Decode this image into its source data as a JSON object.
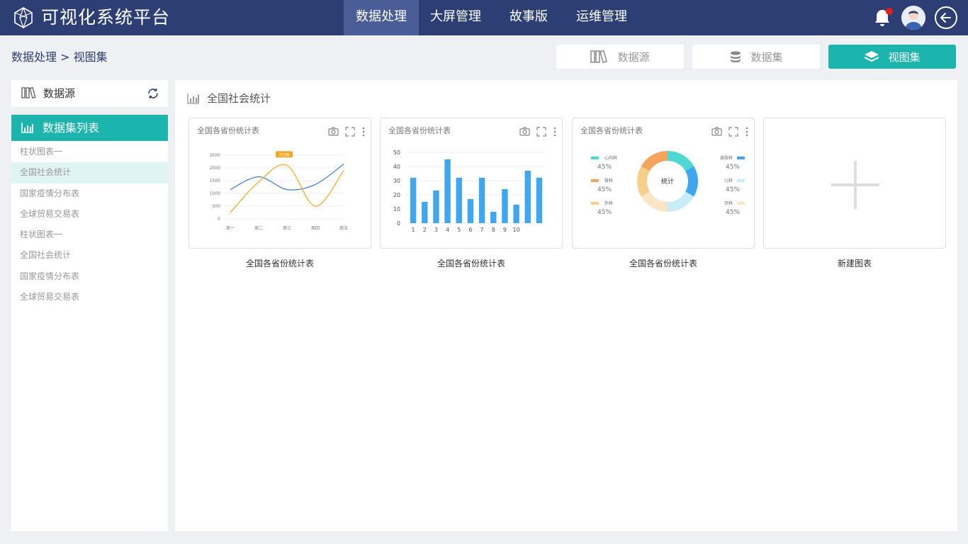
{
  "app": {
    "title": "可视化系统平台"
  },
  "nav": [
    {
      "label": "数据处理",
      "active": true
    },
    {
      "label": "大屏管理",
      "active": false
    },
    {
      "label": "故事版",
      "active": false
    },
    {
      "label": "运维管理",
      "active": false
    }
  ],
  "breadcrumb": "数据处理 > 视图集",
  "view_buttons": [
    {
      "label": "数据源",
      "icon": "books-icon"
    },
    {
      "label": "数据集",
      "icon": "database-icon"
    },
    {
      "label": "视图集",
      "icon": "layers-icon",
      "active": true
    }
  ],
  "sidebar": {
    "source_label": "数据源",
    "list_title": "数据集列表",
    "items": [
      "柱状图表一",
      "全国社会统计",
      "国家疫情分布表",
      "全球贸易交易表",
      "柱状图表一",
      "全国社会统计",
      "国家疫情分布表",
      "全球贸易交易表"
    ],
    "active_index": 1
  },
  "main": {
    "title": "全国社会统计"
  },
  "cards": [
    {
      "title": "全国各省份统计表",
      "caption": "全国各省份统计表"
    },
    {
      "title": "全国各省份统计表",
      "caption": "全国各省份统计表"
    },
    {
      "title": "全国各省份统计表",
      "caption": "全国各省份统计表"
    }
  ],
  "new_card": {
    "caption": "新建图表"
  },
  "colors": {
    "primary": "#1cb5ad",
    "topbar": "#2c3e74",
    "bar": "#3fa7f0",
    "line1": "#3a7bd5",
    "line2": "#f5a623"
  },
  "chart_data": [
    {
      "type": "line",
      "categories": [
        "周一",
        "周二",
        "周三",
        "周四",
        "周五"
      ],
      "yticks": [
        0,
        500,
        1000,
        1500,
        2000,
        2500
      ],
      "ylim": [
        0,
        2500
      ],
      "series": [
        {
          "values": [
            1150,
            1650,
            1150,
            1350,
            2150
          ]
        },
        {
          "values": [
            250,
            1450,
            2100,
            500,
            1900
          ]
        }
      ],
      "tooltip": "2108"
    },
    {
      "type": "bar",
      "categories": [
        "1",
        "2",
        "3",
        "4",
        "5",
        "6",
        "7",
        "8",
        "9",
        "10"
      ],
      "yticks": [
        0,
        10,
        20,
        30,
        40,
        50
      ],
      "ylim": [
        0,
        50
      ],
      "values": [
        32,
        15,
        23,
        45,
        32,
        17,
        32,
        8,
        24,
        13,
        37,
        32
      ]
    },
    {
      "type": "pie",
      "center_label": "统计",
      "slices": [
        {
          "label": "心内科",
          "value": 45,
          "pct": "45%",
          "color": "#4fd8d3"
        },
        {
          "label": "骨科",
          "value": 45,
          "pct": "45%",
          "color": "#f5a45e"
        },
        {
          "label": "外科",
          "value": 45,
          "pct": "45%",
          "color": "#f6d08a"
        },
        {
          "label": "皮肤科",
          "value": 45,
          "pct": "45%",
          "color": "#3fa7f0"
        },
        {
          "label": "儿科",
          "value": 45,
          "pct": "45%",
          "color": "#c8ecf8"
        },
        {
          "label": "牙科",
          "value": 45,
          "pct": "45%",
          "color": "#f8e6c4"
        }
      ]
    }
  ]
}
